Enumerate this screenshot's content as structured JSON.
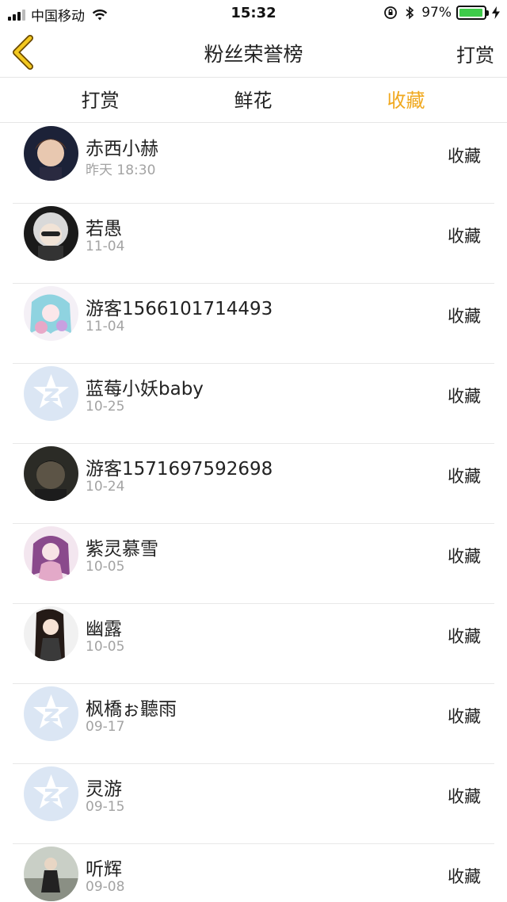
{
  "status_bar": {
    "carrier": "中国移动",
    "time": "15:32",
    "battery": "97%",
    "battery_level": 0.97
  },
  "nav": {
    "title": "粉丝荣誉榜",
    "right_label": "打赏",
    "back_icon": "chevron-left-icon"
  },
  "tabs": [
    {
      "label": "打赏",
      "active": false
    },
    {
      "label": "鲜花",
      "active": false
    },
    {
      "label": "收藏",
      "active": true
    }
  ],
  "accent_color": "#f0a81e",
  "fans": [
    {
      "name": "赤西小赫",
      "date": "昨天 18:30",
      "action": "收藏",
      "avatar": "photo-avatar"
    },
    {
      "name": "若愚",
      "date": "11-04",
      "action": "收藏",
      "avatar": "photo-avatar"
    },
    {
      "name": "游客1566101714493",
      "date": "11-04",
      "action": "收藏",
      "avatar": "photo-avatar"
    },
    {
      "name": "蓝莓小妖baby",
      "date": "10-25",
      "action": "收藏",
      "avatar": "default-avatar-icon"
    },
    {
      "name": "游客1571697592698",
      "date": "10-24",
      "action": "收藏",
      "avatar": "photo-avatar"
    },
    {
      "name": "紫灵慕雪",
      "date": "10-05",
      "action": "收藏",
      "avatar": "photo-avatar"
    },
    {
      "name": "幽露",
      "date": "10-05",
      "action": "收藏",
      "avatar": "photo-avatar"
    },
    {
      "name": "枫橋ぉ聽雨",
      "date": "09-17",
      "action": "收藏",
      "avatar": "default-avatar-icon"
    },
    {
      "name": "灵游",
      "date": "09-15",
      "action": "收藏",
      "avatar": "default-avatar-icon"
    },
    {
      "name": "听辉",
      "date": "09-08",
      "action": "收藏",
      "avatar": "photo-avatar"
    }
  ]
}
